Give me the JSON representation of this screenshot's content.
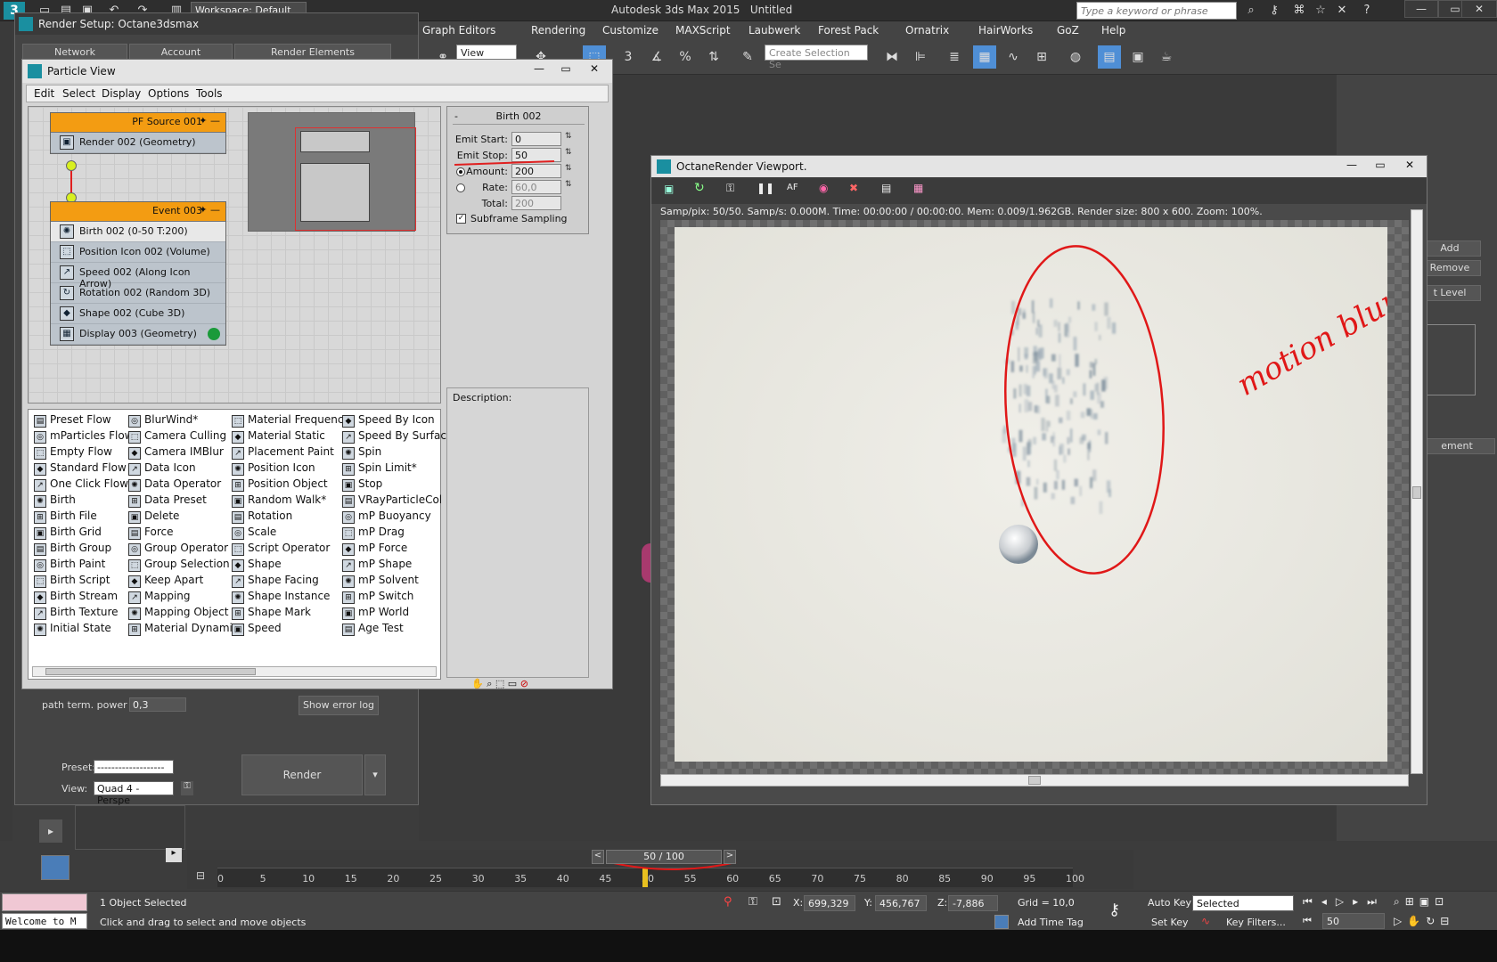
{
  "app": {
    "title": "Autodesk 3ds Max 2015",
    "doc": "Untitled",
    "workspace": "Workspace: Default",
    "search_placeholder": "Type a keyword or phrase"
  },
  "menu": [
    "Graph Editors",
    "Rendering",
    "Customize",
    "MAXScript",
    "Laubwerk",
    "Forest Pack",
    "Ornatrix",
    "HairWorks",
    "GoZ",
    "Help"
  ],
  "toolbar": {
    "view": "View",
    "selection_set": "Create Selection Se"
  },
  "render_setup": {
    "title": "Render Setup: Octane3dsmax",
    "tabs": [
      "Network",
      "Account",
      "Render Elements"
    ],
    "path_term_label": "path term. power",
    "path_term_value": "0,3",
    "show_error_log": "Show error log",
    "preset_label": "Preset:",
    "preset_value": "-------------------",
    "view_label": "View:",
    "view_value": "Quad 4 - Perspe",
    "render_button": "Render"
  },
  "particle_view": {
    "title": "Particle View",
    "menu": [
      "Edit",
      "Select",
      "Display",
      "Options",
      "Tools"
    ],
    "source_node": {
      "title": "PF Source 001",
      "ops": [
        "Render 002 (Geometry)"
      ]
    },
    "event_node": {
      "title": "Event 003",
      "ops": [
        "Birth 002 (0-50 T:200)",
        "Position Icon 002 (Volume)",
        "Speed 002 (Along Icon Arrow)",
        "Rotation 002 (Random 3D)",
        "Shape 002 (Cube 3D)",
        "Display 003 (Geometry)"
      ]
    },
    "params": {
      "header": "Birth 002",
      "collapse": "-",
      "emit_start_label": "Emit Start:",
      "emit_start": "0",
      "emit_stop_label": "Emit Stop:",
      "emit_stop": "50",
      "amount_label": "Amount:",
      "amount": "200",
      "rate_label": "Rate:",
      "rate": "60,0",
      "total_label": "Total:",
      "total": "200",
      "subframe": "Subframe Sampling"
    },
    "description_label": "Description:",
    "depot": [
      [
        "Preset Flow",
        "mParticles Flow",
        "Empty Flow",
        "Standard Flow",
        "One Click Flow",
        "Birth",
        "Birth File",
        "Birth Grid",
        "Birth Group",
        "Birth Paint",
        "Birth Script",
        "Birth Stream",
        "Birth Texture",
        "Initial State"
      ],
      [
        "BlurWind*",
        "Camera Culling",
        "Camera IMBlur",
        "Data Icon",
        "Data Operator",
        "Data Preset",
        "Delete",
        "Force",
        "Group Operator",
        "Group Selection",
        "Keep Apart",
        "Mapping",
        "Mapping Object",
        "Material Dynamic"
      ],
      [
        "Material Frequency",
        "Material Static",
        "Placement Paint",
        "Position Icon",
        "Position Object",
        "Random Walk*",
        "Rotation",
        "Scale",
        "Script Operator",
        "Shape",
        "Shape Facing",
        "Shape Instance",
        "Shape Mark",
        "Speed"
      ],
      [
        "Speed By Icon",
        "Speed By Surfac",
        "Spin",
        "Spin Limit*",
        "Stop",
        "VRayParticleCol",
        "mP Buoyancy",
        "mP Drag",
        "mP Force",
        "mP Shape",
        "mP Solvent",
        "mP Switch",
        "mP World",
        "Age Test"
      ]
    ]
  },
  "octane": {
    "title": "OctaneRender Viewport.",
    "stats": "Samp/pix: 50/50.   Samp/s: 0.000M.   Time: 00:00:00 / 00:00:00.   Mem: 0.009/1.962GB.   Render size: 800 x 600.   Zoom: 100%.",
    "annotation": "motion blur!"
  },
  "right_panel": {
    "add": "Add",
    "remove": "Remove",
    "level": "t Level",
    "element": "ement"
  },
  "timeline": {
    "frame": "50 / 100",
    "ticks": [
      "0",
      "5",
      "10",
      "15",
      "20",
      "25",
      "30",
      "35",
      "40",
      "45",
      "50",
      "55",
      "60",
      "65",
      "70",
      "75",
      "80",
      "85",
      "90",
      "95",
      "100"
    ],
    "current_frame": 50
  },
  "status": {
    "selected": "1 Object Selected",
    "hint": "Click and drag to select and move objects",
    "welcome": "Welcome to M",
    "x_label": "X:",
    "x": "699,329",
    "y_label": "Y:",
    "y": "456,767",
    "z_label": "Z:",
    "z": "-7,886",
    "grid": "Grid = 10,0",
    "add_time_tag": "Add Time Tag",
    "auto_key": "Auto Key",
    "set_key": "Set Key",
    "key_mode": "Selected",
    "key_filters": "Key Filters...",
    "frame_field": "50"
  }
}
